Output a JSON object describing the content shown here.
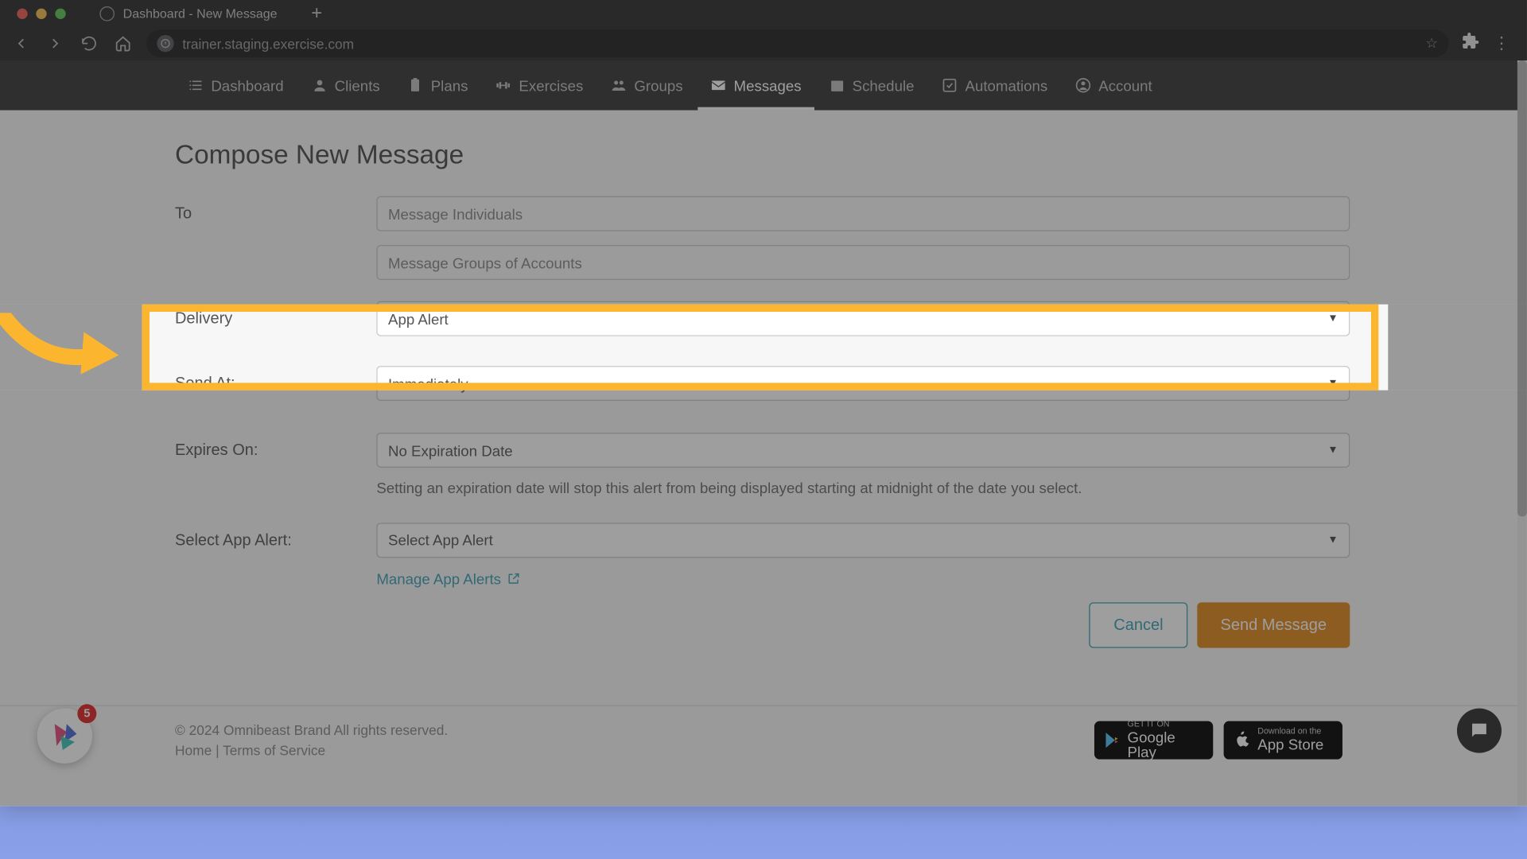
{
  "browser": {
    "tab_title": "Dashboard - New Message",
    "url": "trainer.staging.exercise.com"
  },
  "nav": {
    "items": [
      {
        "label": "Dashboard"
      },
      {
        "label": "Clients"
      },
      {
        "label": "Plans"
      },
      {
        "label": "Exercises"
      },
      {
        "label": "Groups"
      },
      {
        "label": "Messages"
      },
      {
        "label": "Schedule"
      },
      {
        "label": "Automations"
      },
      {
        "label": "Account"
      }
    ]
  },
  "page": {
    "title": "Compose New Message",
    "labels": {
      "to": "To",
      "delivery": "Delivery",
      "send_at": "Send At:",
      "expires_on": "Expires On:",
      "select_app_alert": "Select App Alert:"
    },
    "inputs": {
      "to_individuals_placeholder": "Message Individuals",
      "to_groups_placeholder": "Message Groups of Accounts",
      "delivery_value": "App Alert",
      "send_at_value": "Immediately",
      "expires_value": "No Expiration Date",
      "select_alert_value": "Select App Alert"
    },
    "helper_expires": "Setting an expiration date will stop this alert from being displayed starting at midnight of the date you select.",
    "manage_link": "Manage App Alerts",
    "buttons": {
      "cancel": "Cancel",
      "send": "Send Message"
    }
  },
  "footer": {
    "copyright": "© 2024 Omnibeast Brand All rights reserved.",
    "home": "Home",
    "tos": "Terms of Service",
    "gplay_sm": "GET IT ON",
    "gplay_lg": "Google Play",
    "astore_sm": "Download on the",
    "astore_lg": "App Store"
  },
  "widgets": {
    "badge_count": "5"
  }
}
